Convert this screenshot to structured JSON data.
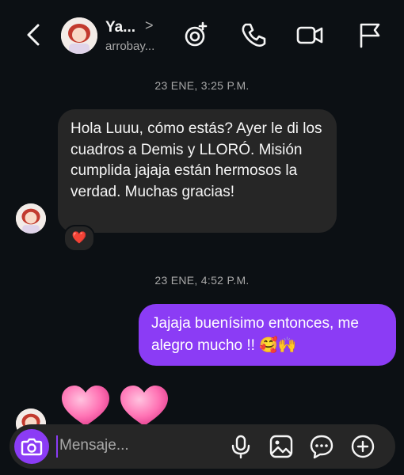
{
  "header": {
    "name": "Ya...",
    "username": "arrobay...",
    "chevron": ">"
  },
  "messages": [
    {
      "timestamp": "23 ENE, 3:25 P.M."
    },
    {
      "text": "Hola Luuu, cómo estás? Ayer le di los cuadros a Demis y LLORÓ. Misión cumplida jajaja están hermosos la verdad. Muchas gracias!",
      "reaction": "❤️"
    },
    {
      "timestamp": "23 ENE, 4:52 P.M."
    },
    {
      "text": "Jajaja buenísimo entonces, me alegro mucho !! 🥰🙌"
    }
  ],
  "reaction_emoji": "❤️",
  "composer": {
    "placeholder": "Mensaje..."
  },
  "icons": [
    "back-chevron",
    "effects",
    "phone",
    "video-camera",
    "flag",
    "camera",
    "microphone",
    "image-gallery",
    "sticker",
    "plus"
  ],
  "colors": {
    "background": "#0c1014",
    "incoming_bubble": "#262626",
    "outgoing_bubble": "#8b3cf5",
    "accent": "#8b3cf5",
    "heart": "#ed4956"
  }
}
